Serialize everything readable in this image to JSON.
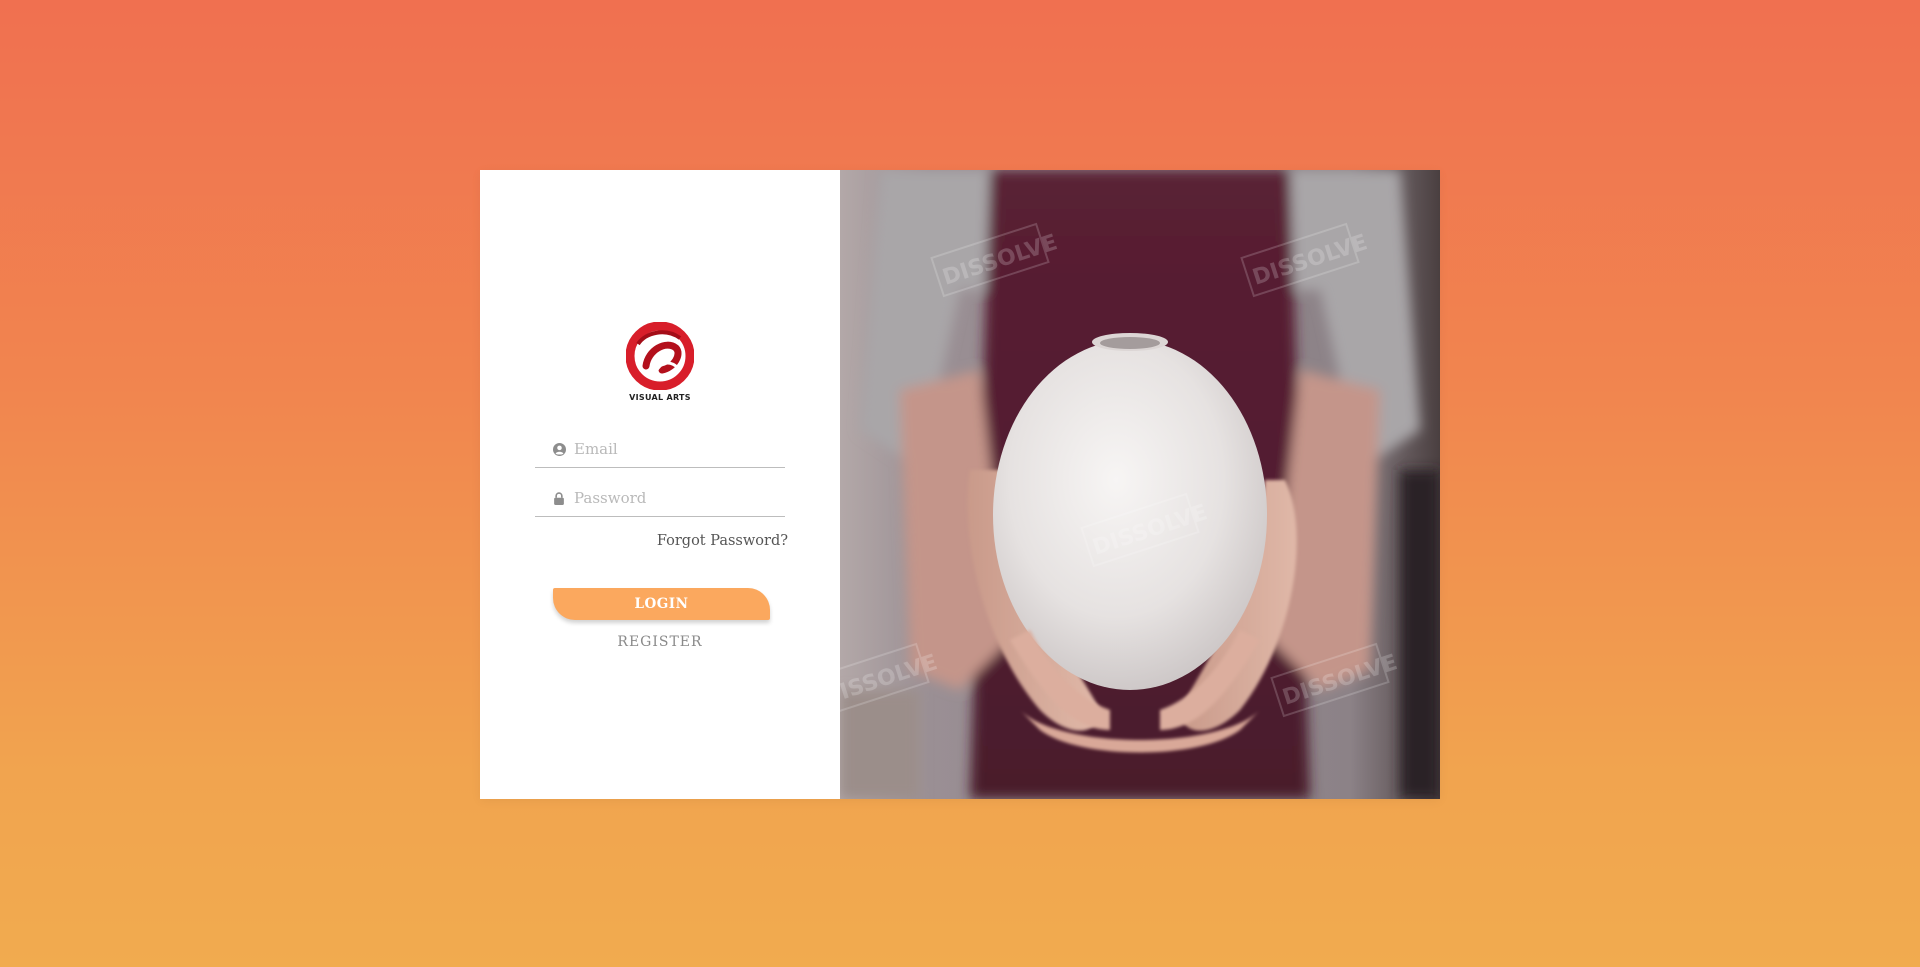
{
  "brand": {
    "logo_text": "VISUAL ARTS",
    "logo_color": "#d81e2a"
  },
  "form": {
    "email_placeholder": "Email",
    "email_value": "",
    "password_placeholder": "Password",
    "password_value": "",
    "forgot_label": "Forgot Password?",
    "login_label": "LOGIN",
    "register_label": "REGISTER"
  },
  "colors": {
    "background_top": "#f07050",
    "background_bottom": "#f1ab4f",
    "login_button": "#fba85e"
  },
  "icons": {
    "email": "user-circle-icon",
    "password": "lock-icon"
  },
  "hero": {
    "watermark": "DISSOLVE"
  }
}
